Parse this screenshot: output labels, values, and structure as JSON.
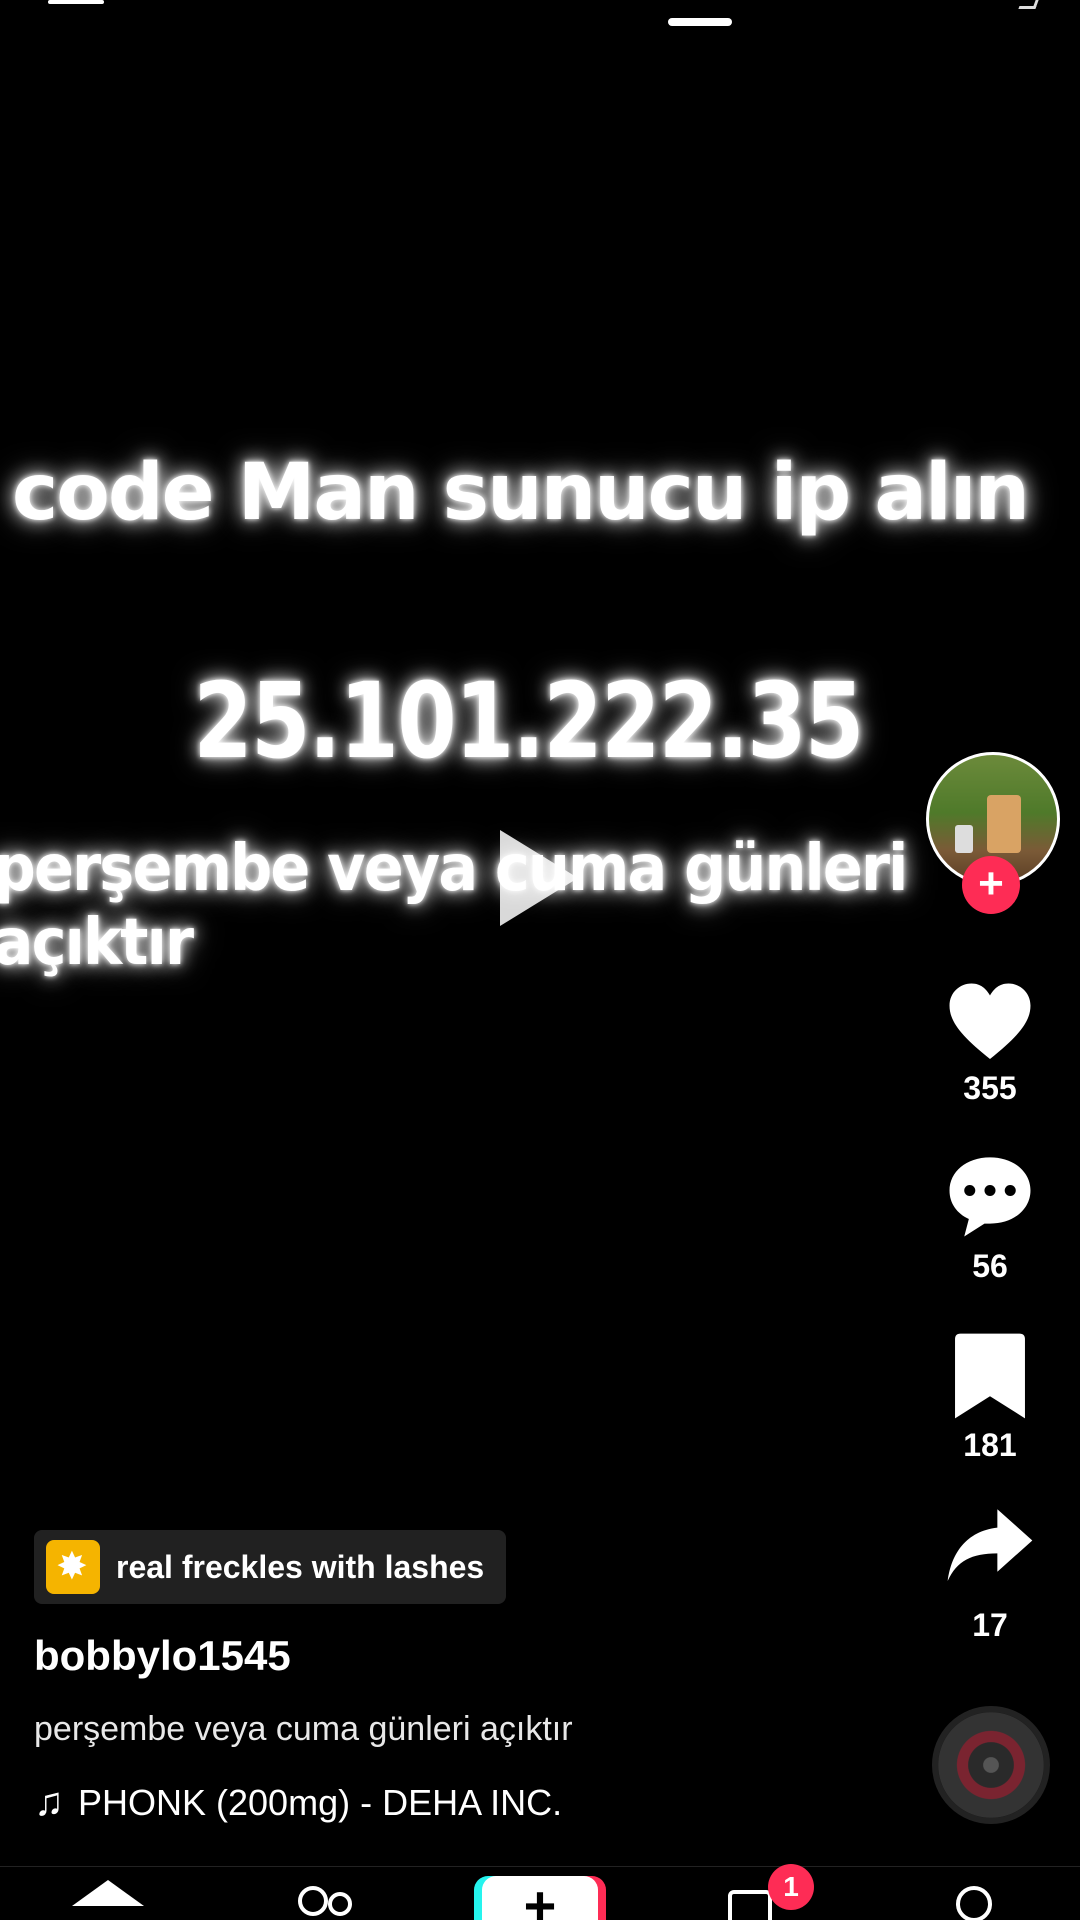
{
  "video": {
    "line1": "code Man sunucu ip alın",
    "line2": "25.101.222.35",
    "line3": "perşembe veya cuma günleri açıktır"
  },
  "actions": {
    "likes": "355",
    "comments": "56",
    "saves": "181",
    "shares": "17"
  },
  "effect": {
    "label": "real freckles with lashes"
  },
  "post": {
    "username": "bobbylo1545",
    "caption": "perşembe veya cuma günleri açıktır",
    "music": "PHONK (200mg) - DEHA INC."
  },
  "nav": {
    "create_label": "+",
    "inbox_badge": "1"
  },
  "colors": {
    "accent": "#fe2c55",
    "accent_cyan": "#25f4ee",
    "background": "#000000"
  }
}
